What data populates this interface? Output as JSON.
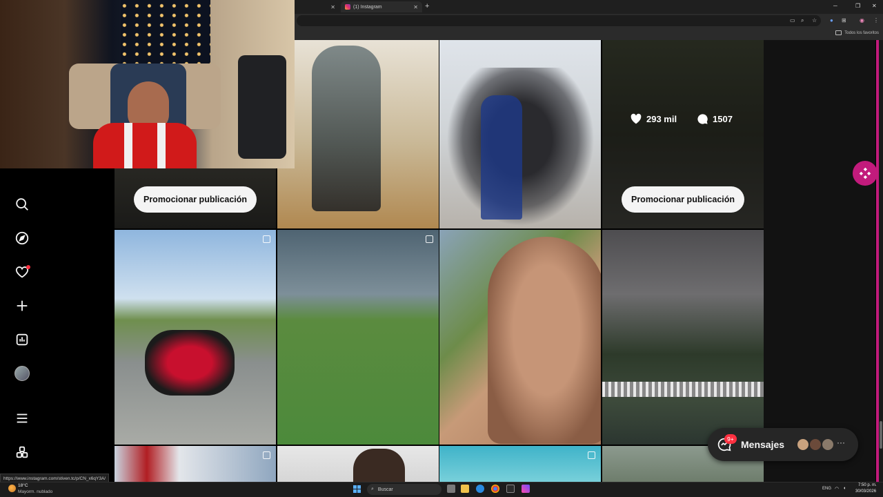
{
  "browser": {
    "tabs": [
      {
        "label": ""
      },
      {
        "label": "(1) Instagram"
      }
    ],
    "new_tab": "+",
    "bookmarks_folder": "Todos los favoritos"
  },
  "posts": [
    {
      "promote_label": "Promocionar publicación"
    },
    {},
    {},
    {
      "likes": "293 mil",
      "comments": "1507",
      "promote_label": "Promocionar publicación"
    },
    {
      "multi": true
    },
    {
      "multi": true
    },
    {},
    {},
    {
      "multi": true
    },
    {},
    {
      "multi": true
    },
    {}
  ],
  "messages": {
    "label": "Mensajes",
    "badge": "9+"
  },
  "status_url": "https://www.instagram.com/stiven.tc/p/CN_x6qY3A/",
  "taskbar": {
    "weather_temp": "18°C",
    "weather_desc": "Mayorm. nublado",
    "search_placeholder": "Buscar",
    "language": "ENG",
    "time": "7:50 p. m.",
    "date": "30/03/2026"
  },
  "colors": {
    "accent_pink": "#c21b7c",
    "notification_red": "#ff3040"
  }
}
